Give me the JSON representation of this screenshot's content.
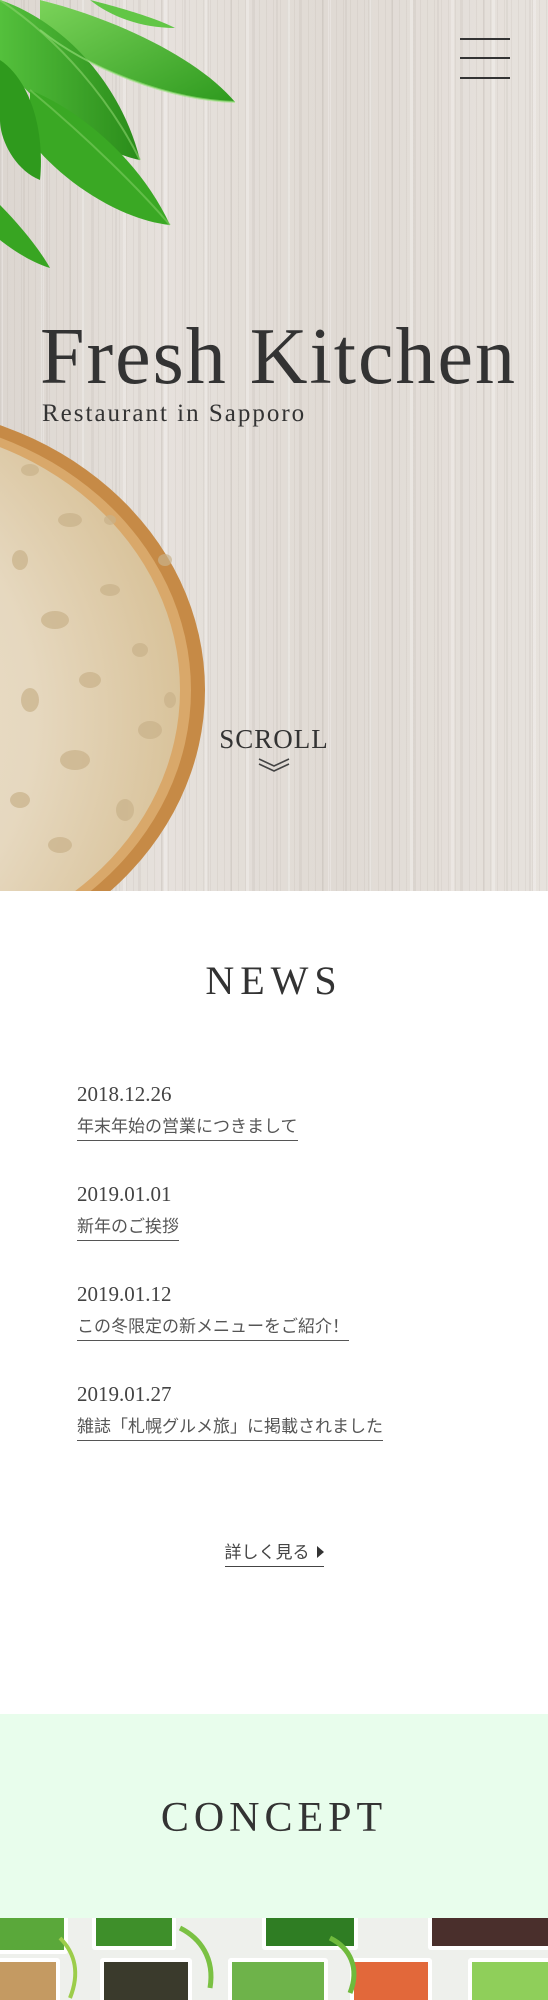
{
  "hero": {
    "title": "Fresh Kitchen",
    "subtitle": "Restaurant in Sapporo",
    "scroll_label": "SCROLL",
    "menu_icon": "hamburger-menu-icon",
    "scroll_icon": "double-chevron-down-icon"
  },
  "news": {
    "title": "NEWS",
    "items": [
      {
        "date": "2018.12.26",
        "title": "年末年始の営業につきまして"
      },
      {
        "date": "2019.01.01",
        "title": "新年のご挨拶"
      },
      {
        "date": "2019.01.12",
        "title": "この冬限定の新メニューをご紹介！"
      },
      {
        "date": "2019.01.27",
        "title": "雑誌「札幌グルメ旅」に掲載されました"
      }
    ],
    "more_label": "詳しく見る",
    "more_icon": "triangle-right-icon"
  },
  "concept": {
    "title": "CONCEPT"
  },
  "colors": {
    "text": "#333333",
    "concept_background": "#e8fdec",
    "leaf_green": "#3fae2a",
    "wood_background": "#e2dcd6",
    "bread_crust": "#c48a4a"
  }
}
